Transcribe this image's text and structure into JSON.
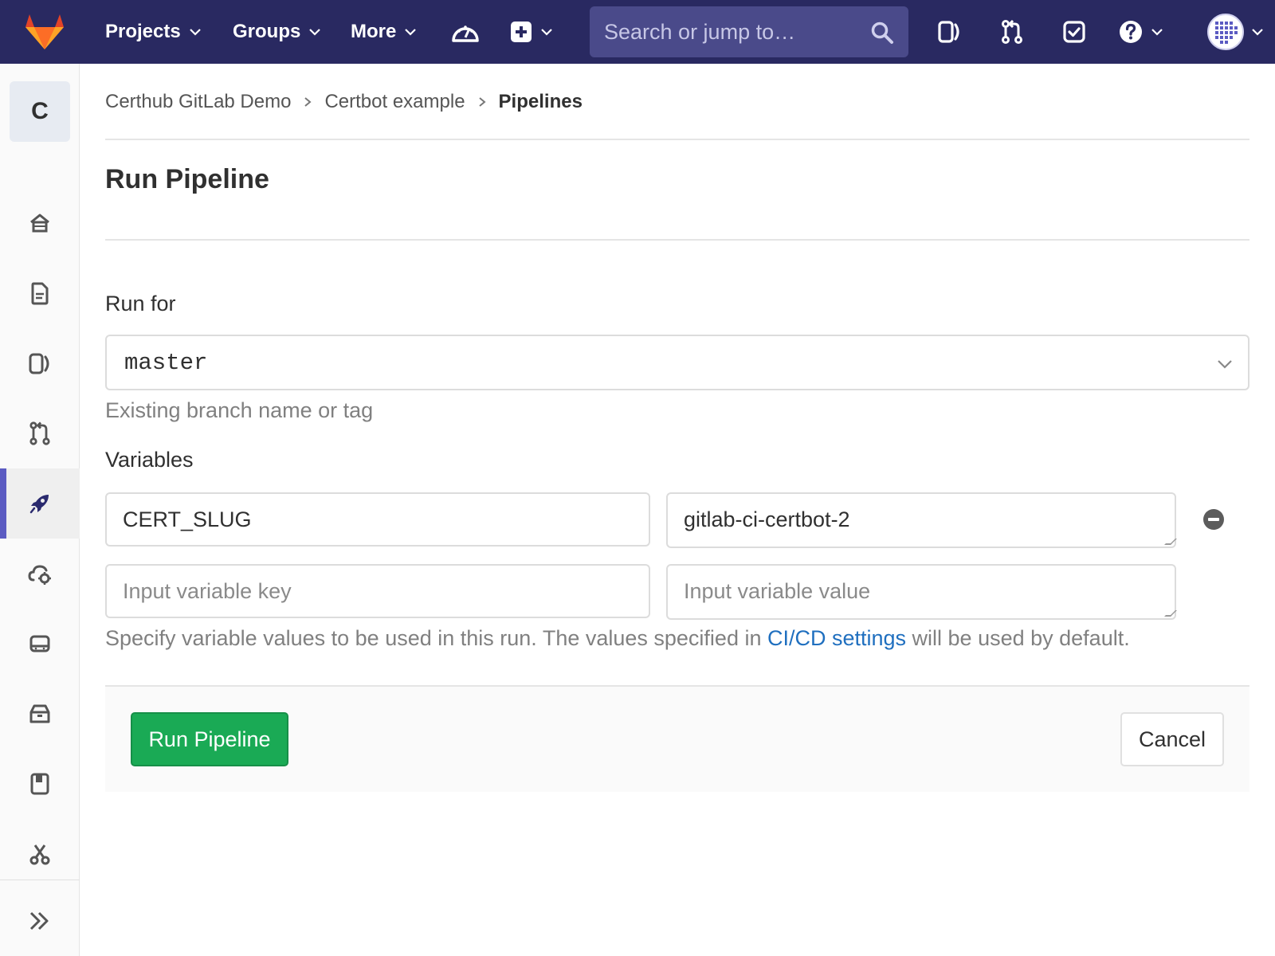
{
  "colors": {
    "navbar": "#292961",
    "accent": "#5b5bc2",
    "primary_button": "#1aaa55",
    "link": "#1f6fbf"
  },
  "navbar": {
    "projects_label": "Projects",
    "groups_label": "Groups",
    "more_label": "More",
    "search_placeholder": "Search or jump to…",
    "icons": [
      "gitlab-logo",
      "dashboard-icon",
      "plus-icon",
      "issues-icon",
      "merge-request-icon",
      "todo-icon",
      "help-icon",
      "user-avatar"
    ]
  },
  "sidebar": {
    "project_avatar_letter": "C",
    "items": [
      "home-icon",
      "repository-icon",
      "issues-icon",
      "merge-requests-icon",
      "ci-cd-icon",
      "operations-icon",
      "packages-icon",
      "analytics-icon",
      "wiki-icon",
      "snippets-icon"
    ],
    "active_item": "ci-cd-icon",
    "collapse_icon": "double-chevron-right-icon"
  },
  "breadcrumb": {
    "items": [
      "Certhub GitLab Demo",
      "Certbot example"
    ],
    "current": "Pipelines"
  },
  "page": {
    "title": "Run Pipeline"
  },
  "form": {
    "run_for_label": "Run for",
    "branch_value": "master",
    "branch_help": "Existing branch name or tag",
    "variables_label": "Variables",
    "variables": [
      {
        "key": "CERT_SLUG",
        "value": "gitlab-ci-certbot-2"
      }
    ],
    "key_placeholder": "Input variable key",
    "value_placeholder": "Input variable value",
    "variables_help_prefix": "Specify variable values to be used in this run. The values specified in ",
    "variables_help_link": "CI/CD settings",
    "variables_help_suffix": " will be used by default."
  },
  "actions": {
    "run_label": "Run Pipeline",
    "cancel_label": "Cancel"
  }
}
